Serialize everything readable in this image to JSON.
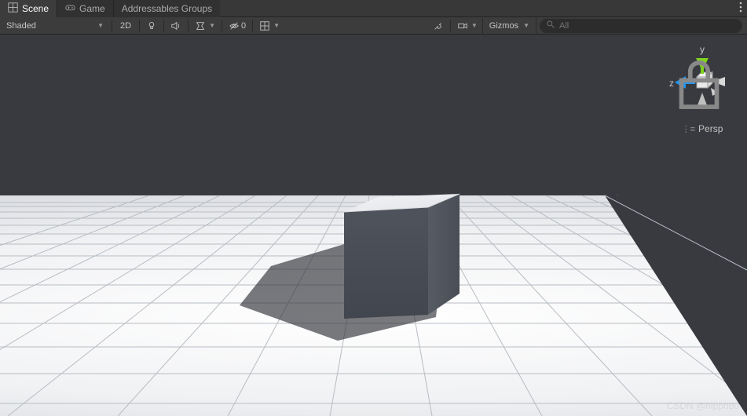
{
  "tabs": {
    "scene": "Scene",
    "game": "Game",
    "addressables": "Addressables Groups"
  },
  "toolbar": {
    "shading_mode": "Shaded",
    "mode_2d": "2D",
    "hidden_count": "0",
    "gizmos_label": "Gizmos",
    "search_placeholder": "All"
  },
  "gizmo": {
    "y_label": "y",
    "z_label": "z",
    "persp_label": "Persp"
  },
  "watermark": "CSDN @hippodu"
}
